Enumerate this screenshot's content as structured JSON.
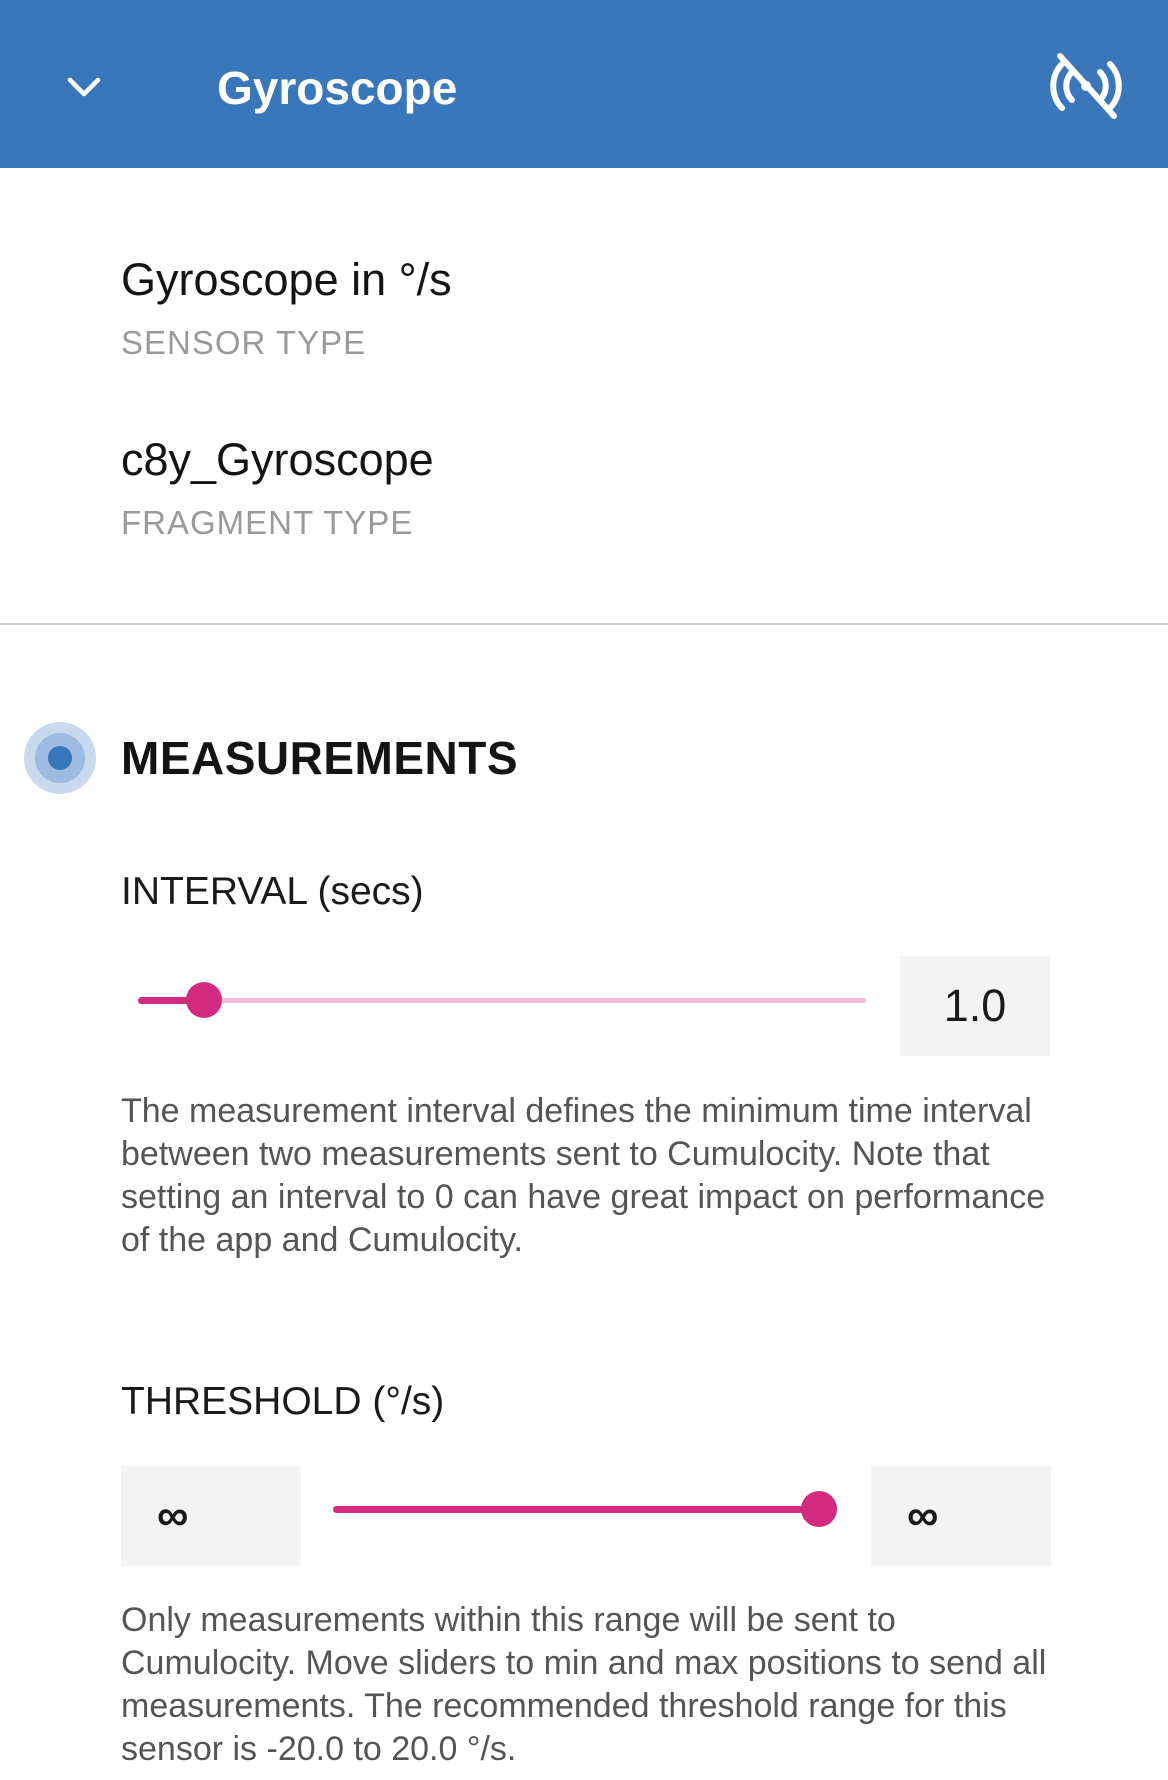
{
  "appbar": {
    "title": "Gyroscope",
    "back_icon": "chevron-down-icon",
    "status_icon": "signal-off-icon",
    "color": "#3A76BA"
  },
  "sensor": {
    "type_value": "Gyroscope in °/s",
    "type_label": "SENSOR TYPE",
    "fragment_value": "c8y_Gyroscope",
    "fragment_label": "FRAGMENT TYPE"
  },
  "measurements": {
    "title": "MEASUREMENTS",
    "interval": {
      "label": "INTERVAL (secs)",
      "value": "1.0",
      "slider_fraction": 0.09,
      "help": "The measurement interval defines the minimum time interval between two measurements sent to Cumulocity. Note that setting an interval to 0 can have great impact on performance of the app and Cumulocity."
    },
    "threshold": {
      "label": "THRESHOLD (°/s)",
      "min_value": "∞",
      "max_value": "∞",
      "slider_fraction": 1.0,
      "help": "Only measurements within this range will be sent to Cumulocity. Move sliders to min and max positions to send all measurements. The recommended threshold range for this sensor is -20.0 to 20.0 °/s."
    }
  },
  "colors": {
    "accent": "#D22A7E",
    "accent_light": "#F0BCD8",
    "section_indicator": "#3A76BA"
  }
}
